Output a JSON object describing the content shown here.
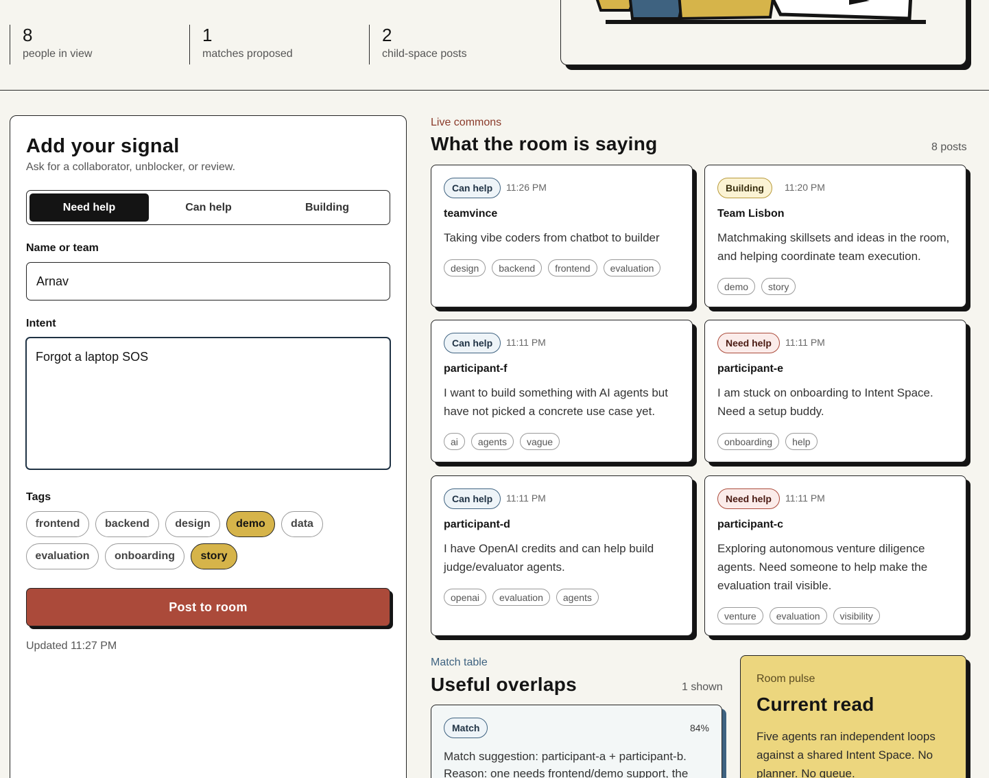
{
  "stats": [
    {
      "value": "8",
      "label": "people in view"
    },
    {
      "value": "1",
      "label": "matches proposed"
    },
    {
      "value": "2",
      "label": "child-space posts"
    }
  ],
  "form": {
    "title": "Add your signal",
    "subtitle": "Ask for a collaborator, unblocker, or review.",
    "modes": [
      "Need help",
      "Can help",
      "Building"
    ],
    "active_mode": "Need help",
    "name_label": "Name or team",
    "name_value": "Arnav",
    "intent_label": "Intent",
    "intent_value": "Forgot a laptop SOS",
    "tags_label": "Tags",
    "tags": [
      {
        "label": "frontend",
        "selected": false
      },
      {
        "label": "backend",
        "selected": false
      },
      {
        "label": "design",
        "selected": false
      },
      {
        "label": "demo",
        "selected": true
      },
      {
        "label": "data",
        "selected": false
      },
      {
        "label": "evaluation",
        "selected": false
      },
      {
        "label": "onboarding",
        "selected": false
      },
      {
        "label": "story",
        "selected": true
      }
    ],
    "submit_label": "Post to room",
    "updated": "Updated 11:27 PM"
  },
  "feed": {
    "kicker": "Live commons",
    "title": "What the room is saying",
    "count": "8 posts",
    "posts": [
      {
        "badge": "Can help",
        "kind": "canhelp",
        "time": "11:26 PM",
        "author": "teamvince",
        "text": "Taking vibe coders from chatbot to builder",
        "tags": [
          "design",
          "backend",
          "frontend",
          "evaluation"
        ]
      },
      {
        "badge": "Building",
        "kind": "building",
        "time": "11:20 PM",
        "author": "Team Lisbon",
        "text": "Matchmaking skillsets and ideas in the room, and helping coordinate team execution.",
        "tags": [
          "demo",
          "story"
        ]
      },
      {
        "badge": "Can help",
        "kind": "canhelp",
        "time": "11:11 PM",
        "author": "participant-f",
        "text": "I want to build something with AI agents but have not picked a concrete use case yet.",
        "tags": [
          "ai",
          "agents",
          "vague"
        ]
      },
      {
        "badge": "Need help",
        "kind": "needhelp",
        "time": "11:11 PM",
        "author": "participant-e",
        "text": "I am stuck on onboarding to Intent Space. Need a setup buddy.",
        "tags": [
          "onboarding",
          "help"
        ]
      },
      {
        "badge": "Can help",
        "kind": "canhelp",
        "time": "11:11 PM",
        "author": "participant-d",
        "text": "I have OpenAI credits and can help build judge/evaluator agents.",
        "tags": [
          "openai",
          "evaluation",
          "agents"
        ]
      },
      {
        "badge": "Need help",
        "kind": "needhelp",
        "time": "11:11 PM",
        "author": "participant-c",
        "text": "Exploring autonomous venture diligence agents. Need someone to help make the evaluation trail visible.",
        "tags": [
          "venture",
          "evaluation",
          "visibility"
        ]
      }
    ]
  },
  "matches": {
    "kicker": "Match table",
    "title": "Useful overlaps",
    "count": "1 shown",
    "item": {
      "badge": "Match",
      "percent": "84%",
      "text": "Match suggestion: participant-a + participant-b. Reason: one needs frontend/demo support, the"
    }
  },
  "pulse": {
    "kicker": "Room pulse",
    "title": "Current read",
    "text": "Five agents ran independent loops against a shared Intent Space. No planner. No queue."
  },
  "colors": {
    "background": "#f6f5ef",
    "ink": "#141414",
    "accent_red": "#ab4a3a",
    "accent_gold": "#d6b44a",
    "accent_blue": "#3e6280",
    "pulse_bg": "#ecd67e"
  }
}
